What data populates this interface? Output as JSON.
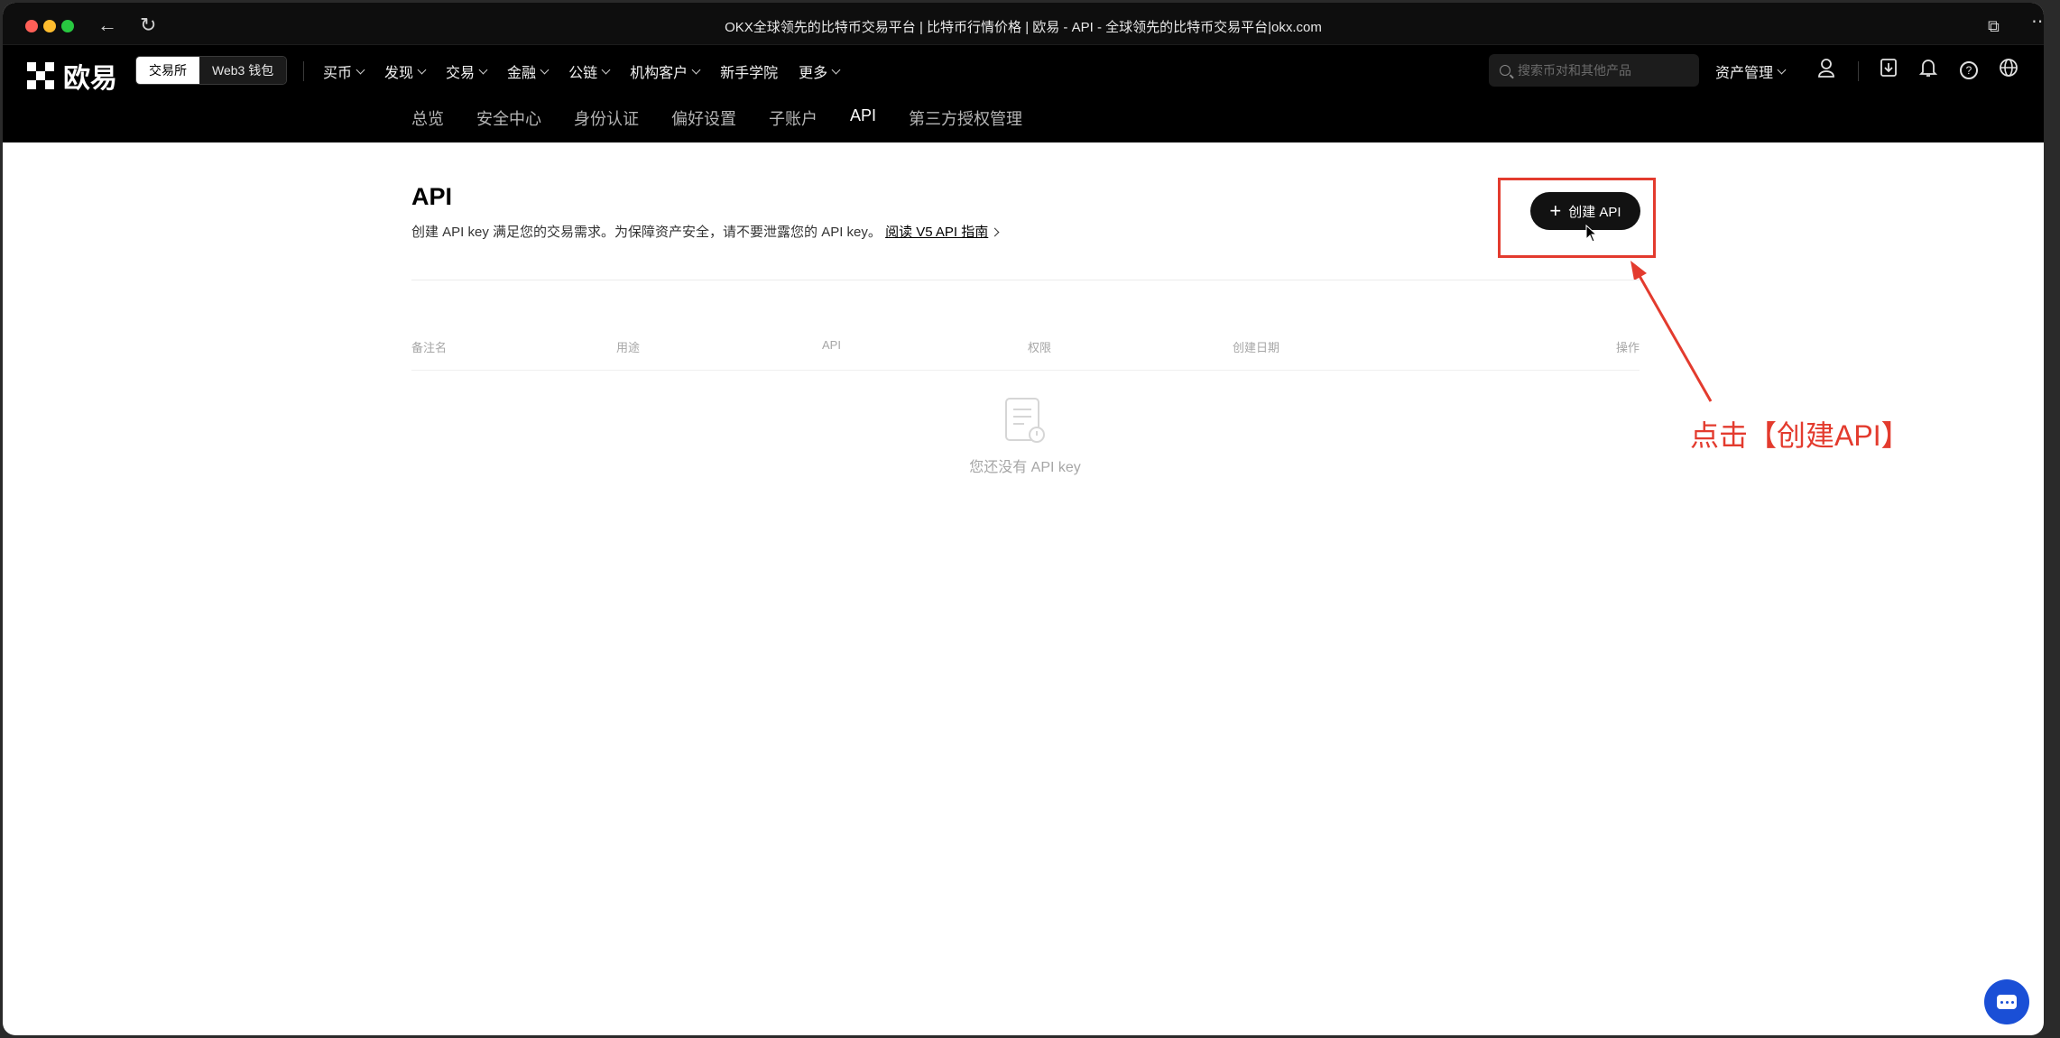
{
  "browser": {
    "title": "OKX全球领先的比特币交易平台 | 比特币行情价格 | 欧易 - API - 全球领先的比特币交易平台|okx.com"
  },
  "header": {
    "logo_text": "欧易",
    "mode_tabs": [
      "交易所",
      "Web3 钱包"
    ],
    "menu": [
      "买币",
      "发现",
      "交易",
      "金融",
      "公链",
      "机构客户",
      "新手学院",
      "更多"
    ],
    "search_placeholder": "搜索币对和其他产品",
    "asset_label": "资产管理"
  },
  "subnav": {
    "items": [
      "总览",
      "安全中心",
      "身份认证",
      "偏好设置",
      "子账户",
      "API",
      "第三方授权管理"
    ],
    "active": "API"
  },
  "main": {
    "title": "API",
    "description": "创建 API key 满足您的交易需求。为保障资产安全，请不要泄露您的 API key。",
    "guide_link": "阅读 V5 API 指南",
    "create_button": "创建 API",
    "table_headers": [
      "备注名",
      "用途",
      "API",
      "权限",
      "创建日期",
      "操作"
    ],
    "empty_text": "您还没有 API key"
  },
  "annotation": {
    "text": "点击【创建API】",
    "color": "#e33b2e"
  },
  "colors": {
    "nav_bg": "#000000",
    "accent": "#121212",
    "chat_bg": "#1a4fd6"
  }
}
